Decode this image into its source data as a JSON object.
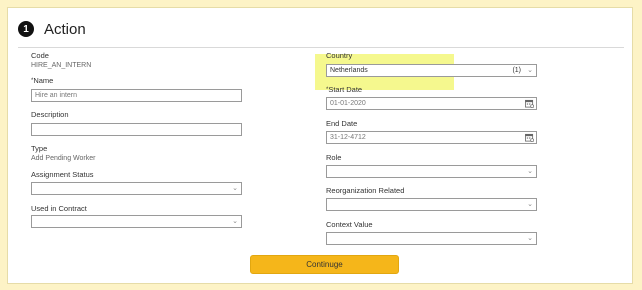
{
  "section": {
    "step_number": "1",
    "title": "Action"
  },
  "left": {
    "code": {
      "label": "Code",
      "value": "HIRE_AN_INTERN"
    },
    "name": {
      "required_mark": "*",
      "label": "Name",
      "value": "Hire an intern"
    },
    "description": {
      "label": "Description",
      "value": ""
    },
    "type": {
      "label": "Type",
      "value": "Add Pending Worker"
    },
    "assignment_status": {
      "label": "Assignment Status",
      "value": ""
    },
    "used_in_contract": {
      "label": "Used in Contract",
      "value": ""
    }
  },
  "right": {
    "country": {
      "label": "Country",
      "value": "Netherlands",
      "count": "(1)"
    },
    "start_date": {
      "required_mark": "*",
      "label": "Start Date",
      "value": "01-01-2020"
    },
    "end_date": {
      "label": "End Date",
      "value": "31-12-4712"
    },
    "role": {
      "label": "Role",
      "value": ""
    },
    "reorganization_related": {
      "label": "Reorganization Related",
      "value": ""
    },
    "context_value": {
      "label": "Context Value",
      "value": ""
    }
  },
  "actions": {
    "continue_label": "Continuge"
  },
  "colors": {
    "accent": "#f5b61a",
    "highlight": "#f3f77a",
    "page_bg": "#fdf3c6"
  },
  "icons": {
    "dropdown": "chevron-down-icon",
    "calendar": "calendar-icon"
  }
}
